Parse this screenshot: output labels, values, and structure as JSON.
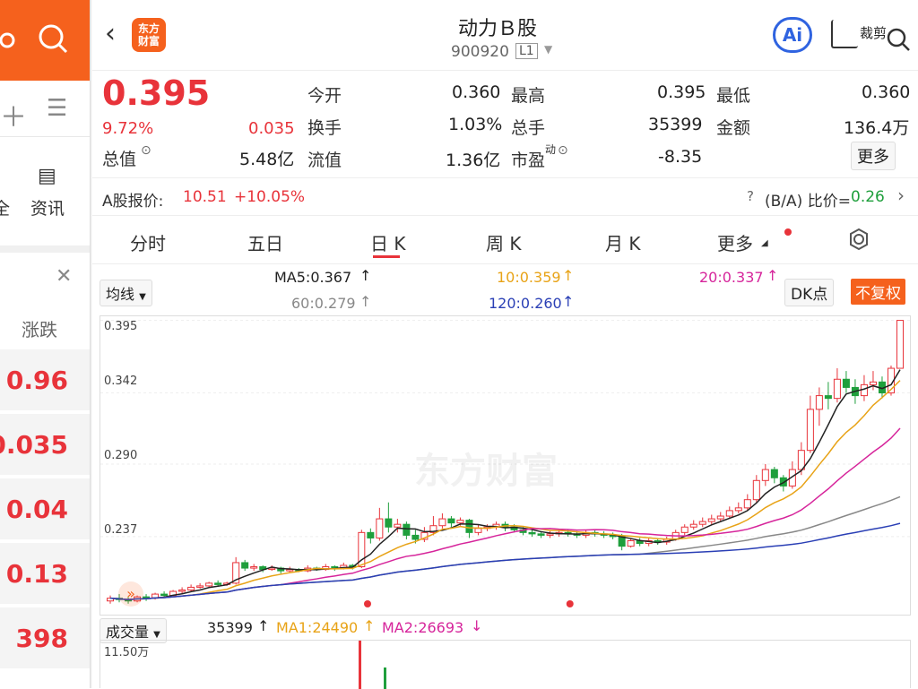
{
  "left_panel": {
    "tab_partial": "全",
    "tab_info": "资讯",
    "col_header": "涨跌",
    "values": [
      "0.96",
      "0.035",
      "0.04",
      "0.13",
      "398"
    ]
  },
  "header": {
    "logo_text": "东方财富",
    "title": "动力Ｂ股",
    "code": "900920",
    "level": "L1",
    "ai_label": "Ai",
    "crop_label": "裁剪"
  },
  "quote": {
    "price": "0.395",
    "change_pct": "9.72%",
    "change": "0.035",
    "total_value_label": "总值",
    "total_value": "5.48亿",
    "fields": [
      {
        "label": "今开",
        "value": "0.360"
      },
      {
        "label": "最高",
        "value": "0.395"
      },
      {
        "label": "最低",
        "value": "0.360"
      },
      {
        "label": "换手",
        "value": "1.03%"
      },
      {
        "label": "总手",
        "value": "35399"
      },
      {
        "label": "金额",
        "value": "136.4万"
      },
      {
        "label": "流值",
        "value": "1.36亿"
      },
      {
        "label": "市盈",
        "value": "-8.35"
      }
    ],
    "pe_suffix": "动",
    "more_button": "更多"
  },
  "a_share": {
    "label": "A股报价:",
    "price": "10.51",
    "change": "+10.05%",
    "ratio_label": "(B/A) 比价=",
    "ratio_value": "0.26"
  },
  "tabs": [
    "分时",
    "五日",
    "日 K",
    "周 K",
    "月 K",
    "更多"
  ],
  "active_tab": "日 K",
  "ma": {
    "selector": "均线",
    "ma5": "MA5:0.367",
    "ma10": "10:0.359",
    "ma20": "20:0.337",
    "ma60": "60:0.279",
    "ma120": "120:0.260",
    "dk_button": "DK点",
    "adjust_button": "不复权"
  },
  "chart_data": {
    "type": "candlestick",
    "y_ticks": [
      "0.395",
      "0.342",
      "0.290",
      "0.237"
    ],
    "ylim": [
      0.18,
      0.398
    ],
    "watermark": "东方财富",
    "candles": [
      [
        0.19,
        0.192,
        0.194,
        0.188
      ],
      [
        0.192,
        0.191,
        0.195,
        0.189
      ],
      [
        0.191,
        0.19,
        0.193,
        0.188
      ],
      [
        0.19,
        0.193,
        0.194,
        0.189
      ],
      [
        0.193,
        0.192,
        0.195,
        0.19
      ],
      [
        0.192,
        0.195,
        0.196,
        0.191
      ],
      [
        0.195,
        0.194,
        0.197,
        0.192
      ],
      [
        0.194,
        0.197,
        0.198,
        0.193
      ],
      [
        0.197,
        0.198,
        0.2,
        0.195
      ],
      [
        0.198,
        0.2,
        0.202,
        0.197
      ],
      [
        0.2,
        0.201,
        0.203,
        0.199
      ],
      [
        0.201,
        0.203,
        0.204,
        0.2
      ],
      [
        0.203,
        0.202,
        0.205,
        0.201
      ],
      [
        0.202,
        0.203,
        0.204,
        0.201
      ],
      [
        0.203,
        0.218,
        0.222,
        0.202
      ],
      [
        0.218,
        0.214,
        0.22,
        0.212
      ],
      [
        0.214,
        0.215,
        0.217,
        0.212
      ],
      [
        0.215,
        0.213,
        0.216,
        0.211
      ],
      [
        0.213,
        0.214,
        0.216,
        0.212
      ],
      [
        0.214,
        0.212,
        0.215,
        0.21
      ],
      [
        0.212,
        0.213,
        0.215,
        0.211
      ],
      [
        0.213,
        0.212,
        0.214,
        0.211
      ],
      [
        0.212,
        0.214,
        0.216,
        0.211
      ],
      [
        0.214,
        0.213,
        0.215,
        0.212
      ],
      [
        0.213,
        0.215,
        0.217,
        0.212
      ],
      [
        0.215,
        0.214,
        0.216,
        0.212
      ],
      [
        0.214,
        0.216,
        0.218,
        0.213
      ],
      [
        0.216,
        0.215,
        0.217,
        0.213
      ],
      [
        0.215,
        0.24,
        0.242,
        0.214
      ],
      [
        0.24,
        0.236,
        0.243,
        0.232
      ],
      [
        0.236,
        0.25,
        0.258,
        0.234
      ],
      [
        0.25,
        0.244,
        0.262,
        0.24
      ],
      [
        0.244,
        0.246,
        0.25,
        0.24
      ],
      [
        0.246,
        0.238,
        0.248,
        0.235
      ],
      [
        0.238,
        0.235,
        0.242,
        0.232
      ],
      [
        0.235,
        0.24,
        0.244,
        0.233
      ],
      [
        0.24,
        0.245,
        0.252,
        0.238
      ],
      [
        0.245,
        0.25,
        0.254,
        0.243
      ],
      [
        0.25,
        0.247,
        0.252,
        0.244
      ],
      [
        0.247,
        0.249,
        0.251,
        0.245
      ],
      [
        0.249,
        0.24,
        0.25,
        0.236
      ],
      [
        0.24,
        0.243,
        0.246,
        0.238
      ],
      [
        0.243,
        0.244,
        0.246,
        0.241
      ],
      [
        0.244,
        0.246,
        0.248,
        0.242
      ],
      [
        0.246,
        0.244,
        0.248,
        0.241
      ],
      [
        0.244,
        0.242,
        0.246,
        0.24
      ],
      [
        0.242,
        0.24,
        0.244,
        0.238
      ],
      [
        0.24,
        0.239,
        0.242,
        0.237
      ],
      [
        0.239,
        0.238,
        0.241,
        0.236
      ],
      [
        0.238,
        0.239,
        0.241,
        0.236
      ],
      [
        0.239,
        0.24,
        0.242,
        0.237
      ],
      [
        0.24,
        0.239,
        0.242,
        0.237
      ],
      [
        0.239,
        0.238,
        0.241,
        0.236
      ],
      [
        0.238,
        0.24,
        0.242,
        0.236
      ],
      [
        0.24,
        0.239,
        0.242,
        0.237
      ],
      [
        0.239,
        0.238,
        0.241,
        0.236
      ],
      [
        0.238,
        0.237,
        0.24,
        0.235
      ],
      [
        0.237,
        0.23,
        0.239,
        0.227
      ],
      [
        0.23,
        0.234,
        0.236,
        0.229
      ],
      [
        0.234,
        0.232,
        0.236,
        0.23
      ],
      [
        0.232,
        0.234,
        0.236,
        0.23
      ],
      [
        0.234,
        0.233,
        0.236,
        0.231
      ],
      [
        0.233,
        0.235,
        0.237,
        0.231
      ],
      [
        0.235,
        0.24,
        0.242,
        0.234
      ],
      [
        0.24,
        0.244,
        0.246,
        0.238
      ],
      [
        0.244,
        0.246,
        0.249,
        0.242
      ],
      [
        0.246,
        0.248,
        0.251,
        0.244
      ],
      [
        0.248,
        0.25,
        0.253,
        0.246
      ],
      [
        0.25,
        0.252,
        0.255,
        0.248
      ],
      [
        0.252,
        0.256,
        0.259,
        0.25
      ],
      [
        0.256,
        0.258,
        0.262,
        0.254
      ],
      [
        0.258,
        0.264,
        0.268,
        0.256
      ],
      [
        0.264,
        0.278,
        0.282,
        0.262
      ],
      [
        0.278,
        0.286,
        0.29,
        0.274
      ],
      [
        0.286,
        0.28,
        0.288,
        0.276
      ],
      [
        0.28,
        0.274,
        0.282,
        0.27
      ],
      [
        0.274,
        0.286,
        0.292,
        0.272
      ],
      [
        0.286,
        0.3,
        0.306,
        0.282
      ],
      [
        0.3,
        0.33,
        0.34,
        0.298
      ],
      [
        0.33,
        0.34,
        0.346,
        0.318
      ],
      [
        0.34,
        0.338,
        0.35,
        0.33
      ],
      [
        0.338,
        0.352,
        0.36,
        0.335
      ],
      [
        0.352,
        0.346,
        0.358,
        0.342
      ],
      [
        0.346,
        0.34,
        0.352,
        0.334
      ],
      [
        0.34,
        0.348,
        0.355,
        0.336
      ],
      [
        0.348,
        0.35,
        0.358,
        0.344
      ],
      [
        0.35,
        0.342,
        0.354,
        0.338
      ],
      [
        0.342,
        0.36,
        0.362,
        0.34
      ],
      [
        0.36,
        0.395,
        0.395,
        0.36
      ]
    ]
  },
  "volume": {
    "selector": "成交量",
    "value": "35399",
    "ma1": "MA1:24490",
    "ma2": "MA2:26693",
    "y_max": "11.50万"
  }
}
